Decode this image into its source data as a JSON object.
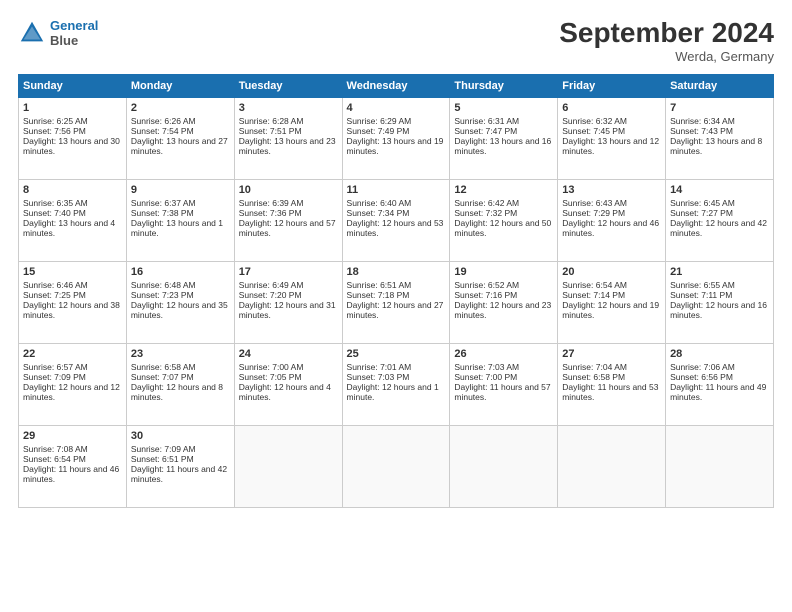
{
  "header": {
    "logo_line1": "General",
    "logo_line2": "Blue",
    "month": "September 2024",
    "location": "Werda, Germany"
  },
  "days_header": [
    "Sunday",
    "Monday",
    "Tuesday",
    "Wednesday",
    "Thursday",
    "Friday",
    "Saturday"
  ],
  "weeks": [
    [
      {
        "day": "1",
        "sunrise": "Sunrise: 6:25 AM",
        "sunset": "Sunset: 7:56 PM",
        "daylight": "Daylight: 13 hours and 30 minutes."
      },
      {
        "day": "2",
        "sunrise": "Sunrise: 6:26 AM",
        "sunset": "Sunset: 7:54 PM",
        "daylight": "Daylight: 13 hours and 27 minutes."
      },
      {
        "day": "3",
        "sunrise": "Sunrise: 6:28 AM",
        "sunset": "Sunset: 7:51 PM",
        "daylight": "Daylight: 13 hours and 23 minutes."
      },
      {
        "day": "4",
        "sunrise": "Sunrise: 6:29 AM",
        "sunset": "Sunset: 7:49 PM",
        "daylight": "Daylight: 13 hours and 19 minutes."
      },
      {
        "day": "5",
        "sunrise": "Sunrise: 6:31 AM",
        "sunset": "Sunset: 7:47 PM",
        "daylight": "Daylight: 13 hours and 16 minutes."
      },
      {
        "day": "6",
        "sunrise": "Sunrise: 6:32 AM",
        "sunset": "Sunset: 7:45 PM",
        "daylight": "Daylight: 13 hours and 12 minutes."
      },
      {
        "day": "7",
        "sunrise": "Sunrise: 6:34 AM",
        "sunset": "Sunset: 7:43 PM",
        "daylight": "Daylight: 13 hours and 8 minutes."
      }
    ],
    [
      {
        "day": "8",
        "sunrise": "Sunrise: 6:35 AM",
        "sunset": "Sunset: 7:40 PM",
        "daylight": "Daylight: 13 hours and 4 minutes."
      },
      {
        "day": "9",
        "sunrise": "Sunrise: 6:37 AM",
        "sunset": "Sunset: 7:38 PM",
        "daylight": "Daylight: 13 hours and 1 minute."
      },
      {
        "day": "10",
        "sunrise": "Sunrise: 6:39 AM",
        "sunset": "Sunset: 7:36 PM",
        "daylight": "Daylight: 12 hours and 57 minutes."
      },
      {
        "day": "11",
        "sunrise": "Sunrise: 6:40 AM",
        "sunset": "Sunset: 7:34 PM",
        "daylight": "Daylight: 12 hours and 53 minutes."
      },
      {
        "day": "12",
        "sunrise": "Sunrise: 6:42 AM",
        "sunset": "Sunset: 7:32 PM",
        "daylight": "Daylight: 12 hours and 50 minutes."
      },
      {
        "day": "13",
        "sunrise": "Sunrise: 6:43 AM",
        "sunset": "Sunset: 7:29 PM",
        "daylight": "Daylight: 12 hours and 46 minutes."
      },
      {
        "day": "14",
        "sunrise": "Sunrise: 6:45 AM",
        "sunset": "Sunset: 7:27 PM",
        "daylight": "Daylight: 12 hours and 42 minutes."
      }
    ],
    [
      {
        "day": "15",
        "sunrise": "Sunrise: 6:46 AM",
        "sunset": "Sunset: 7:25 PM",
        "daylight": "Daylight: 12 hours and 38 minutes."
      },
      {
        "day": "16",
        "sunrise": "Sunrise: 6:48 AM",
        "sunset": "Sunset: 7:23 PM",
        "daylight": "Daylight: 12 hours and 35 minutes."
      },
      {
        "day": "17",
        "sunrise": "Sunrise: 6:49 AM",
        "sunset": "Sunset: 7:20 PM",
        "daylight": "Daylight: 12 hours and 31 minutes."
      },
      {
        "day": "18",
        "sunrise": "Sunrise: 6:51 AM",
        "sunset": "Sunset: 7:18 PM",
        "daylight": "Daylight: 12 hours and 27 minutes."
      },
      {
        "day": "19",
        "sunrise": "Sunrise: 6:52 AM",
        "sunset": "Sunset: 7:16 PM",
        "daylight": "Daylight: 12 hours and 23 minutes."
      },
      {
        "day": "20",
        "sunrise": "Sunrise: 6:54 AM",
        "sunset": "Sunset: 7:14 PM",
        "daylight": "Daylight: 12 hours and 19 minutes."
      },
      {
        "day": "21",
        "sunrise": "Sunrise: 6:55 AM",
        "sunset": "Sunset: 7:11 PM",
        "daylight": "Daylight: 12 hours and 16 minutes."
      }
    ],
    [
      {
        "day": "22",
        "sunrise": "Sunrise: 6:57 AM",
        "sunset": "Sunset: 7:09 PM",
        "daylight": "Daylight: 12 hours and 12 minutes."
      },
      {
        "day": "23",
        "sunrise": "Sunrise: 6:58 AM",
        "sunset": "Sunset: 7:07 PM",
        "daylight": "Daylight: 12 hours and 8 minutes."
      },
      {
        "day": "24",
        "sunrise": "Sunrise: 7:00 AM",
        "sunset": "Sunset: 7:05 PM",
        "daylight": "Daylight: 12 hours and 4 minutes."
      },
      {
        "day": "25",
        "sunrise": "Sunrise: 7:01 AM",
        "sunset": "Sunset: 7:03 PM",
        "daylight": "Daylight: 12 hours and 1 minute."
      },
      {
        "day": "26",
        "sunrise": "Sunrise: 7:03 AM",
        "sunset": "Sunset: 7:00 PM",
        "daylight": "Daylight: 11 hours and 57 minutes."
      },
      {
        "day": "27",
        "sunrise": "Sunrise: 7:04 AM",
        "sunset": "Sunset: 6:58 PM",
        "daylight": "Daylight: 11 hours and 53 minutes."
      },
      {
        "day": "28",
        "sunrise": "Sunrise: 7:06 AM",
        "sunset": "Sunset: 6:56 PM",
        "daylight": "Daylight: 11 hours and 49 minutes."
      }
    ],
    [
      {
        "day": "29",
        "sunrise": "Sunrise: 7:08 AM",
        "sunset": "Sunset: 6:54 PM",
        "daylight": "Daylight: 11 hours and 46 minutes."
      },
      {
        "day": "30",
        "sunrise": "Sunrise: 7:09 AM",
        "sunset": "Sunset: 6:51 PM",
        "daylight": "Daylight: 11 hours and 42 minutes."
      },
      {
        "day": "",
        "sunrise": "",
        "sunset": "",
        "daylight": ""
      },
      {
        "day": "",
        "sunrise": "",
        "sunset": "",
        "daylight": ""
      },
      {
        "day": "",
        "sunrise": "",
        "sunset": "",
        "daylight": ""
      },
      {
        "day": "",
        "sunrise": "",
        "sunset": "",
        "daylight": ""
      },
      {
        "day": "",
        "sunrise": "",
        "sunset": "",
        "daylight": ""
      }
    ]
  ]
}
